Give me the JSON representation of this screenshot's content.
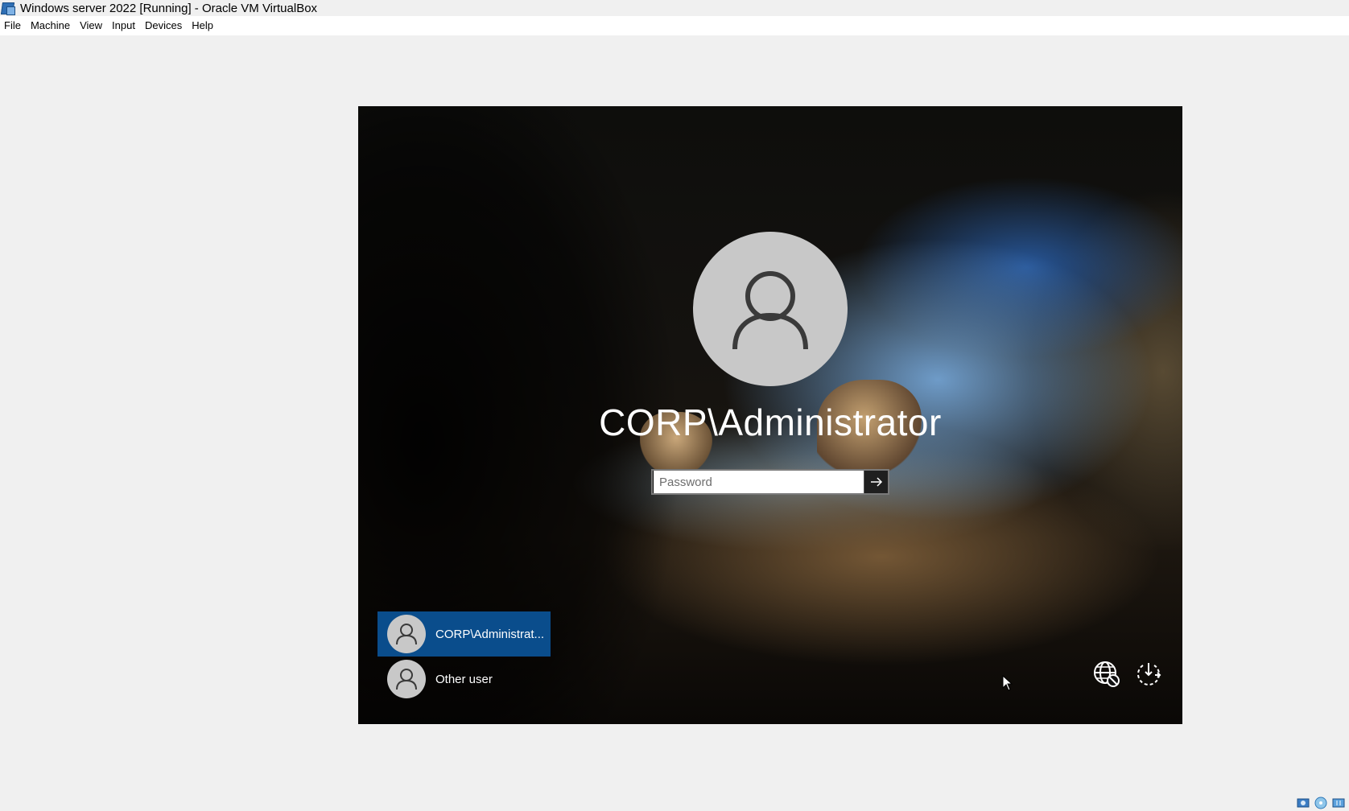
{
  "window": {
    "title": "Windows server 2022 [Running] - Oracle VM VirtualBox",
    "icon": "virtualbox-icon"
  },
  "menubar": {
    "items": [
      "File",
      "Machine",
      "View",
      "Input",
      "Devices",
      "Help"
    ]
  },
  "login": {
    "username": "CORP\\Administrator",
    "password_placeholder": "Password",
    "password_value": "",
    "submit_icon": "arrow-right-icon"
  },
  "users": [
    {
      "label": "CORP\\Administrat...",
      "selected": true,
      "icon": "user-icon"
    },
    {
      "label": "Other user",
      "selected": false,
      "icon": "user-icon"
    }
  ],
  "corner": {
    "network_icon": "network-globe-icon",
    "power_icon": "power-icon"
  },
  "colors": {
    "selected_tile": "#0a4d8c",
    "avatar_bg": "#c8c8c8",
    "window_bg": "#f0f0f0"
  },
  "status_bar_icons": [
    "hard-disk-icon",
    "optical-drive-icon",
    "usb-icon"
  ]
}
